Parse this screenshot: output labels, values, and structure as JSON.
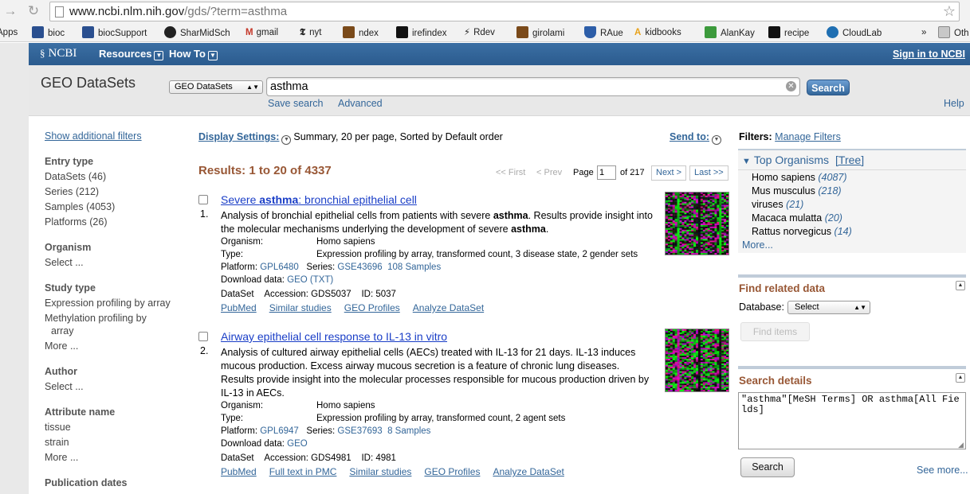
{
  "browser": {
    "url_host": "www.ncbi.nlm.nih.gov",
    "url_path": "/gds/?term=asthma",
    "bookmarks": [
      {
        "label": "Apps",
        "icon": "apps-grid-icon",
        "color": "#4a7fd6"
      },
      {
        "label": "bioc",
        "icon": "bioc-icon",
        "color": "#2a4f8f"
      },
      {
        "label": "biocSupport",
        "icon": "bioc-icon",
        "color": "#2a4f8f"
      },
      {
        "label": "SharMidSch",
        "icon": "swirl-icon",
        "color": "#222222"
      },
      {
        "label": "gmail",
        "icon": "gmail-icon",
        "color": "#c5382a"
      },
      {
        "label": "nyt",
        "icon": "nyt-icon",
        "color": "#111111"
      },
      {
        "label": "ndex",
        "icon": "ndex-icon",
        "color": "#7a4a1a"
      },
      {
        "label": "irefindex",
        "icon": "terminal-icon",
        "color": "#111111"
      },
      {
        "label": "Rdev",
        "icon": "rdev-icon",
        "color": "#666666"
      },
      {
        "label": "girolami",
        "icon": "girolami-icon",
        "color": "#7a4a1a"
      },
      {
        "label": "RAue",
        "icon": "shield-icon",
        "color": "#2d5ea8"
      },
      {
        "label": "kidbooks",
        "icon": "kidbooks-icon",
        "color": "#e8a21a"
      },
      {
        "label": "AlanKay",
        "icon": "q-icon",
        "color": "#3c9a3c"
      },
      {
        "label": "recipe",
        "icon": "envelope-icon",
        "color": "#111111"
      },
      {
        "label": "CloudLab",
        "icon": "cloud-icon",
        "color": "#1f6fb2"
      }
    ],
    "overflow": "»",
    "other_bookmarks": "Oth"
  },
  "ncbi": {
    "logo": "NCBI",
    "menus": [
      "Resources",
      "How To"
    ],
    "sign_in": "Sign in to NCBI"
  },
  "search": {
    "db_title": "GEO DataSets",
    "db_select": "GEO DataSets",
    "term": "asthma",
    "button": "Search",
    "save_search": "Save search",
    "advanced": "Advanced",
    "help": "Help"
  },
  "filters_left": {
    "show_additional": "Show additional filters",
    "groups": [
      {
        "heading": "Entry type",
        "items": [
          "DataSets (46)",
          "Series (212)",
          "Samples (4053)",
          "Platforms (26)"
        ]
      },
      {
        "heading": "Organism",
        "items": [
          "Select ..."
        ]
      },
      {
        "heading": "Study type",
        "items": [
          "Expression profiling by array",
          "Methylation profiling by",
          "array",
          "More ..."
        ]
      },
      {
        "heading": "Author",
        "items": [
          "Select ..."
        ]
      },
      {
        "heading": "Attribute name",
        "items": [
          "tissue",
          "strain",
          "More ..."
        ]
      },
      {
        "heading": "Publication dates",
        "items": []
      }
    ]
  },
  "results": {
    "display_settings_label": "Display Settings:",
    "display_settings_value": "Summary, 20 per page, Sorted by Default order",
    "send_to": "Send to:",
    "count_text": "Results: 1 to 20 of 4337",
    "pager": {
      "first": "<< First",
      "prev": "< Prev",
      "page_label": "Page",
      "page": "1",
      "of": "of 217",
      "next": "Next >",
      "last": "Last >>"
    },
    "items": [
      {
        "num": "1.",
        "title_pre": "Severe ",
        "title_bold": "asthma",
        "title_post": ": bronchial epithelial cell",
        "desc_parts": [
          "Analysis of bronchial epithelial cells from patients with severe ",
          "asthma",
          ". Results provide insight into the molecular mechanisms underlying the development of severe ",
          "asthma",
          "."
        ],
        "organism_label": "Organism:",
        "organism": "Homo sapiens",
        "type_label": "Type:",
        "type": "Expression profiling by array, transformed count, 3 disease state, 2 gender sets",
        "platform_label": "Platform:",
        "platform": "GPL6480",
        "series_label": "Series:",
        "series": "GSE43696",
        "samples": "108 Samples",
        "download_label": "Download data:",
        "download": "GEO (TXT)",
        "dataset_label": "DataSet",
        "accession": "Accession: GDS5037",
        "id": "ID: 5037",
        "links": [
          "PubMed",
          "Similar studies",
          "GEO Profiles",
          "Analyze DataSet"
        ]
      },
      {
        "num": "2.",
        "title_pre": "Airway epithelial cell response to IL-13 in vitro",
        "title_bold": "",
        "title_post": "",
        "desc_parts": [
          "Analysis of cultured airway epithelial cells (AECs) treated with IL-13 for 21 days. IL-13 induces mucous production. Excess airway mucous secretion is a feature of chronic lung diseases. Results provide insight into the molecular processes responsible for mucous production driven by IL-13 in AECs.",
          "",
          "",
          "",
          ""
        ],
        "organism_label": "Organism:",
        "organism": "Homo sapiens",
        "type_label": "Type:",
        "type": "Expression profiling by array, transformed count, 2 agent sets",
        "platform_label": "Platform:",
        "platform": "GPL6947",
        "series_label": "Series:",
        "series": "GSE37693",
        "samples": "8 Samples",
        "download_label": "Download data:",
        "download": "GEO",
        "dataset_label": "DataSet",
        "accession": "Accession: GDS4981",
        "id": "ID: 4981",
        "links": [
          "PubMed",
          "Full text in PMC",
          "Similar studies",
          "GEO Profiles",
          "Analyze DataSet"
        ]
      }
    ]
  },
  "right": {
    "filters_label": "Filters:",
    "manage_filters": "Manage Filters",
    "top_organisms": "Top Organisms",
    "tree": "[Tree]",
    "organisms": [
      {
        "name": "Homo sapiens",
        "count": "(4087)"
      },
      {
        "name": "Mus musculus",
        "count": "(218)"
      },
      {
        "name": "viruses",
        "count": "(21)"
      },
      {
        "name": "Macaca mulatta",
        "count": "(20)"
      },
      {
        "name": "Rattus norvegicus",
        "count": "(14)"
      }
    ],
    "more": "More...",
    "find_related": "Find related data",
    "database_label": "Database:",
    "database_select": "Select",
    "find_items": "Find items",
    "search_details": "Search details",
    "details_text": "\"asthma\"[MeSH Terms] OR asthma[All Fields]",
    "search_button": "Search",
    "see_more": "See more..."
  }
}
